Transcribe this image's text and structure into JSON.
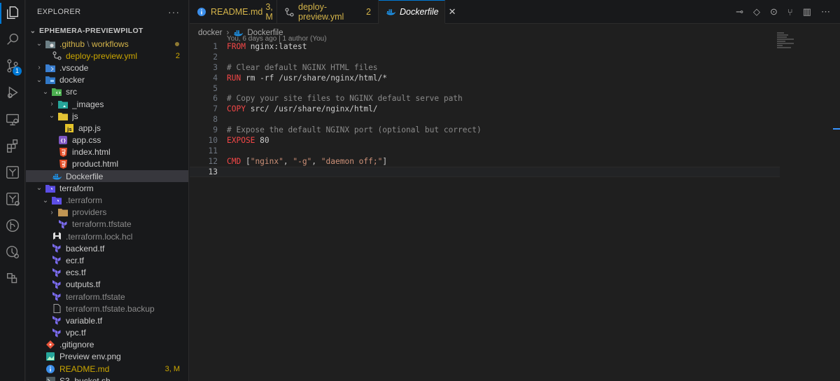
{
  "activity_bar": [
    {
      "name": "explorer-icon",
      "active": true
    },
    {
      "name": "search-icon"
    },
    {
      "name": "source-control-icon",
      "badge": "1"
    },
    {
      "name": "run-debug-icon"
    },
    {
      "name": "remote-explorer-icon"
    },
    {
      "name": "extensions-icon"
    },
    {
      "name": "terraform-icon"
    },
    {
      "name": "terraform-cloud-icon"
    },
    {
      "name": "git-graph-icon"
    },
    {
      "name": "git-history-icon"
    },
    {
      "name": "containers-icon"
    }
  ],
  "sidebar": {
    "title": "EXPLORER",
    "more": "···",
    "root": "EPHEMERA-PREVIEWPILOT",
    "rows": [
      {
        "label": "",
        "seg1": ".github",
        "seg2": "workflows",
        "depth": 1,
        "chev": "⌄",
        "icon": "folder-github",
        "dot": true
      },
      {
        "label": "deploy-preview.yml",
        "depth": 2,
        "icon": "workflow",
        "status": "2",
        "cls": "yellow"
      },
      {
        "label": ".vscode",
        "depth": 1,
        "chev": "›",
        "icon": "folder-vscode"
      },
      {
        "label": "docker",
        "depth": 1,
        "chev": "⌄",
        "icon": "folder-docker"
      },
      {
        "label": "src",
        "depth": 2,
        "chev": "⌄",
        "icon": "folder-src"
      },
      {
        "label": "_images",
        "depth": 3,
        "chev": "›",
        "icon": "folder-images"
      },
      {
        "label": "js",
        "depth": 3,
        "chev": "⌄",
        "icon": "folder-js"
      },
      {
        "label": "app.js",
        "depth": 4,
        "icon": "js"
      },
      {
        "label": "app.css",
        "depth": 3,
        "icon": "css"
      },
      {
        "label": "index.html",
        "depth": 3,
        "icon": "html"
      },
      {
        "label": "product.html",
        "depth": 3,
        "icon": "html"
      },
      {
        "label": "Dockerfile",
        "depth": 2,
        "icon": "docker",
        "selected": true
      },
      {
        "label": "terraform",
        "depth": 1,
        "chev": "⌄",
        "icon": "folder-terraform"
      },
      {
        "label": ".terraform",
        "depth": 2,
        "chev": "⌄",
        "icon": "folder-terraform",
        "cls": "dim"
      },
      {
        "label": "providers",
        "depth": 3,
        "chev": "›",
        "icon": "folder",
        "cls": "dim"
      },
      {
        "label": "terraform.tfstate",
        "depth": 3,
        "icon": "terraform",
        "cls": "dim"
      },
      {
        "label": ".terraform.lock.hcl",
        "depth": 2,
        "icon": "hcl",
        "cls": "dim"
      },
      {
        "label": "backend.tf",
        "depth": 2,
        "icon": "terraform"
      },
      {
        "label": "ecr.tf",
        "depth": 2,
        "icon": "terraform"
      },
      {
        "label": "ecs.tf",
        "depth": 2,
        "icon": "terraform"
      },
      {
        "label": "outputs.tf",
        "depth": 2,
        "icon": "terraform"
      },
      {
        "label": "terraform.tfstate",
        "depth": 2,
        "icon": "terraform",
        "cls": "dim"
      },
      {
        "label": "terraform.tfstate.backup",
        "depth": 2,
        "icon": "file",
        "cls": "dim"
      },
      {
        "label": "variable.tf",
        "depth": 2,
        "icon": "terraform"
      },
      {
        "label": "vpc.tf",
        "depth": 2,
        "icon": "terraform"
      },
      {
        "label": ".gitignore",
        "depth": 1,
        "icon": "git"
      },
      {
        "label": "Preview env.png",
        "depth": 1,
        "icon": "image"
      },
      {
        "label": "README.md",
        "depth": 1,
        "icon": "info",
        "status": "3, M",
        "cls": "yellow"
      },
      {
        "label": "S3_bucket.sh",
        "depth": 1,
        "icon": "shell"
      }
    ]
  },
  "tabs": [
    {
      "label": "README.md",
      "status": "3, M",
      "icon": "info",
      "cls": "yellow"
    },
    {
      "label": "deploy-preview.yml",
      "status": "2",
      "icon": "workflow",
      "cls": "yellow"
    },
    {
      "label": "Dockerfile",
      "icon": "docker",
      "active": true,
      "close": "✕"
    }
  ],
  "breadcrumb": {
    "folder": "docker",
    "sep": "›",
    "file": "Dockerfile"
  },
  "blame": "You, 6 days ago | 1 author (You)",
  "code": [
    {
      "n": "1",
      "parts": [
        {
          "t": "FROM",
          "c": "kw"
        },
        {
          "t": " nginx:latest",
          "c": ""
        }
      ]
    },
    {
      "n": "2",
      "parts": []
    },
    {
      "n": "3",
      "parts": [
        {
          "t": "# Clear default NGINX HTML files",
          "c": "cm-g"
        }
      ]
    },
    {
      "n": "4",
      "parts": [
        {
          "t": "RUN",
          "c": "kw"
        },
        {
          "t": " rm -rf /usr/share/nginx/html/*",
          "c": ""
        }
      ]
    },
    {
      "n": "5",
      "parts": []
    },
    {
      "n": "6",
      "parts": [
        {
          "t": "# Copy your site files to NGINX default serve path",
          "c": "cm-g"
        }
      ]
    },
    {
      "n": "7",
      "parts": [
        {
          "t": "COPY",
          "c": "kw"
        },
        {
          "t": " src/ /usr/share/nginx/html/",
          "c": ""
        }
      ]
    },
    {
      "n": "8",
      "parts": []
    },
    {
      "n": "9",
      "parts": [
        {
          "t": "# Expose the default NGINX port (optional but correct)",
          "c": "cm-g"
        }
      ]
    },
    {
      "n": "10",
      "parts": [
        {
          "t": "EXPOSE",
          "c": "kw"
        },
        {
          "t": " 80",
          "c": ""
        }
      ]
    },
    {
      "n": "11",
      "parts": []
    },
    {
      "n": "12",
      "parts": [
        {
          "t": "CMD",
          "c": "kw"
        },
        {
          "t": " [",
          "c": ""
        },
        {
          "t": "\"nginx\"",
          "c": "str"
        },
        {
          "t": ", ",
          "c": ""
        },
        {
          "t": "\"-g\"",
          "c": "str"
        },
        {
          "t": ", ",
          "c": ""
        },
        {
          "t": "\"daemon off;\"",
          "c": "str"
        },
        {
          "t": "]",
          "c": ""
        }
      ]
    },
    {
      "n": "13",
      "parts": [],
      "current": true
    }
  ]
}
